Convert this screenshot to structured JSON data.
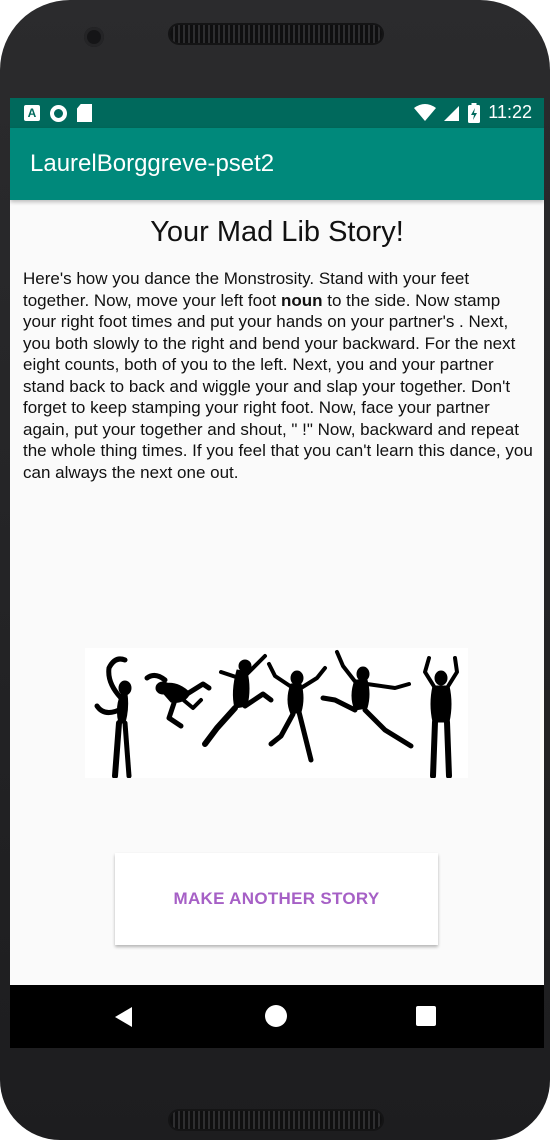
{
  "status_bar": {
    "time": "11:22",
    "icons": [
      "a-notification-icon",
      "circle-notification-icon",
      "sd-card-icon",
      "wifi-icon",
      "signal-icon",
      "battery-charging-icon"
    ]
  },
  "app_bar": {
    "title": "LaurelBorggreve-pset2"
  },
  "story": {
    "title": "Your Mad Lib Story!",
    "text_before_bold": "Here's how you dance the Monstrosity. Stand with your feet together. Now, move your left foot ",
    "bold_word": "noun",
    "text_after_bold": " to the side. Now stamp your right foot times and put your hands on your partner's . Next, you both slowly to the right and bend your backward. For the next eight counts, both of you to the left. Next, you and your partner stand back to back and wiggle your and slap your together. Don't forget to keep stamping your right foot. Now, face your partner again, put your together and shout, \" !\" Now, backward and repeat the whole thing times. If you feel that you can't learn this dance, you can always the next one out."
  },
  "image": {
    "icon": "dancer-silhouettes-image"
  },
  "button": {
    "label": "MAKE ANOTHER STORY",
    "color": "#a660c6"
  },
  "nav_bar": {
    "icons": [
      "back-icon",
      "home-icon",
      "recents-icon"
    ]
  },
  "colors": {
    "status_bar": "#00695c",
    "app_bar": "#00897b",
    "background": "#fafafa"
  }
}
